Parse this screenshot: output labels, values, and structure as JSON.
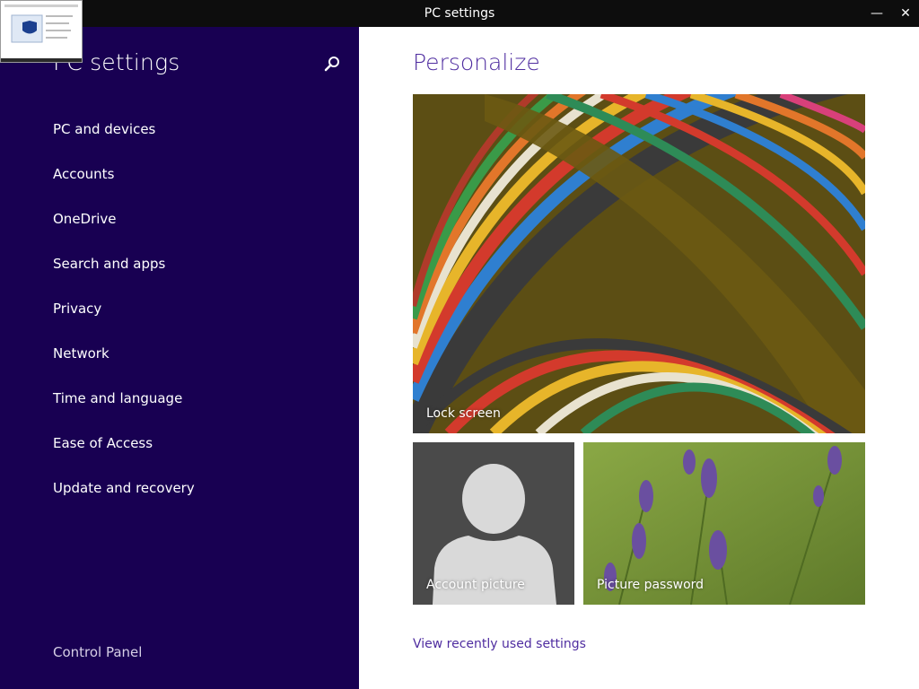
{
  "window": {
    "title": "PC settings",
    "minimize_glyph": "—",
    "close_glyph": "✕"
  },
  "sidebar": {
    "heading": "PC settings",
    "items": [
      {
        "label": "PC and devices"
      },
      {
        "label": "Accounts"
      },
      {
        "label": "OneDrive"
      },
      {
        "label": "Search and apps"
      },
      {
        "label": "Privacy"
      },
      {
        "label": "Network"
      },
      {
        "label": "Time and language"
      },
      {
        "label": "Ease of Access"
      },
      {
        "label": "Update and recovery"
      }
    ],
    "control_panel": "Control Panel"
  },
  "main": {
    "title": "Personalize",
    "tiles": {
      "lock_screen": "Lock screen",
      "account_picture": "Account picture",
      "picture_password": "Picture password"
    },
    "recent_link": "View recently used settings"
  },
  "colors": {
    "sidebar_bg": "#180052",
    "accent": "#4f2da0",
    "titlebar_bg": "#0d0d0d"
  },
  "icons": {
    "search": "search-icon",
    "minimize": "minimize-icon",
    "close": "close-icon"
  }
}
